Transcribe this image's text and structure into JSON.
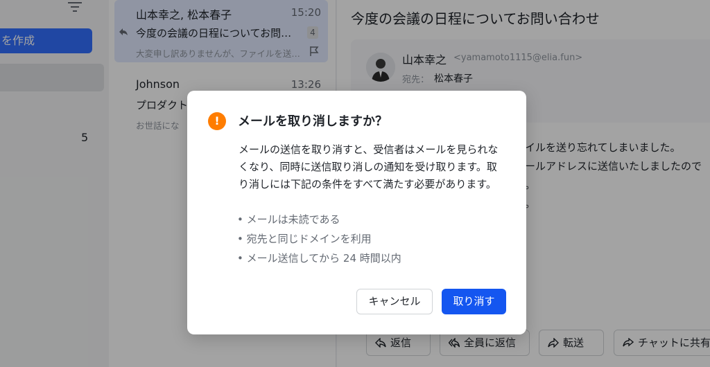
{
  "sidebar": {
    "compose_label": "を作成",
    "folder_count": "5"
  },
  "mail_list": [
    {
      "sender": "山本幸之, 松本春子",
      "time": "15:20",
      "subject": "今度の会議の日程についてお問い合わせ",
      "preview": "大変申し訳ありませんが、ファイルを送り忘れてしまいました。",
      "thread_count": "4",
      "selected": true
    },
    {
      "sender": "Johnson",
      "time": "13:26",
      "subject": "プロダクト",
      "preview": "お世話にな",
      "selected": false
    }
  ],
  "reading_pane": {
    "title": "今度の会議の日程についてお問い合わせ",
    "from_name": "山本幸之",
    "from_email": "<yamamoto1115@elia.fun>",
    "to_label": "宛先：",
    "to_value": "松本春子",
    "body_lines": [
      "イルを送り忘れてしまいました。",
      "ールアドレスに送信いたしましたので",
      "。",
      "。"
    ],
    "actions": {
      "reply": "返信",
      "reply_all": "全員に返信",
      "forward": "転送",
      "share_chat": "チャットに共有"
    }
  },
  "dialog": {
    "title": "メールを取り消しますか？",
    "body": "メールの送信を取り消すと、受信者はメールを見られなくなり、同時に送信取り消しの通知を受け取ります。取り消しには下記の条件をすべて満たす必要があります。",
    "conditions": [
      "• メールは未読である",
      "• 宛先と同じドメインを利用",
      "• メール送信してから 24 時間以内"
    ],
    "cancel_label": "キャンセル",
    "confirm_label": "取り消す",
    "warning_glyph": "!"
  },
  "colors": {
    "accent": "#1456f0",
    "warning": "#ff7d00",
    "selected_item": "#e1eaff"
  }
}
